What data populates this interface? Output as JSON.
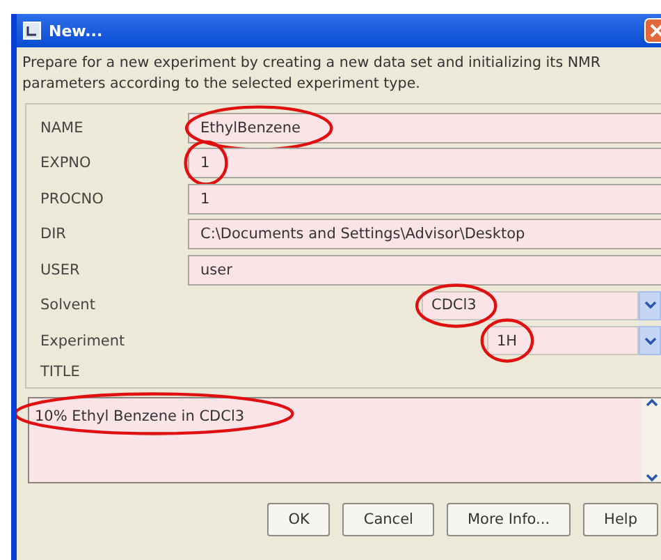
{
  "window": {
    "title": "New..."
  },
  "description": "Prepare for a new experiment by creating a new data set and initializing its NMR parameters according to the selected experiment type.",
  "fields": [
    {
      "kind": "text",
      "label": "NAME",
      "value": "EthylBenzene",
      "circled": true
    },
    {
      "kind": "text",
      "label": "EXPNO",
      "value": "1",
      "circled": true
    },
    {
      "kind": "text",
      "label": "PROCNO",
      "value": "1",
      "circled": false
    },
    {
      "kind": "text",
      "label": "DIR",
      "value": "C:\\Documents and Settings\\Advisor\\Desktop",
      "circled": false
    },
    {
      "kind": "text",
      "label": "USER",
      "value": "user",
      "circled": false
    },
    {
      "kind": "combo",
      "label": "Solvent",
      "value": "CDCl3",
      "circled": true
    },
    {
      "kind": "combo",
      "label": "Experiment",
      "value": "1H",
      "circled": true
    }
  ],
  "title_field": {
    "label": "TITLE",
    "value": "10% Ethyl Benzene in CDCl3",
    "circled": true
  },
  "buttons": [
    "OK",
    "Cancel",
    "More Info...",
    "Help"
  ]
}
